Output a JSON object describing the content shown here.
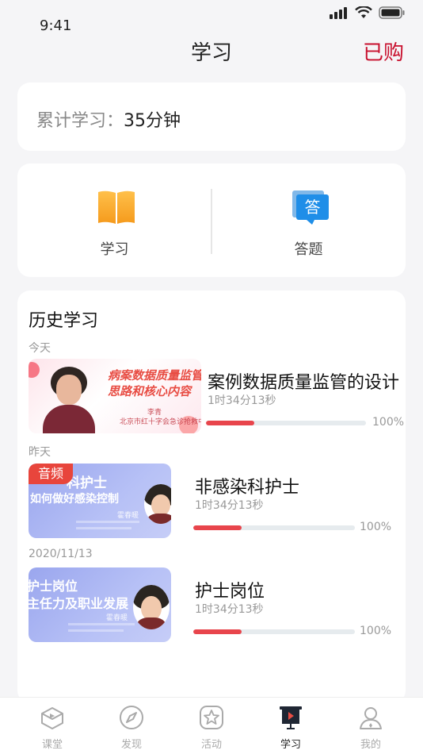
{
  "status_bar": {
    "time": "9:41"
  },
  "nav": {
    "title": "学习",
    "right_label": "已购"
  },
  "summary": {
    "label": "累计学习：",
    "value": "35分钟"
  },
  "entries": [
    {
      "label": "学习",
      "icon": "book-icon"
    },
    {
      "label": "答题",
      "icon": "answer-icon",
      "icon_text": "答"
    }
  ],
  "history": {
    "title": "历史学习",
    "groups": [
      {
        "date": "今天",
        "items": [
          {
            "title": "案例数据质量监管的设计",
            "duration": "1时34分13秒",
            "progress_percent": "100%",
            "progress_fill": 0.3,
            "thumb_lines": [
              "病案数据质量监管的设计",
              "思路和核心内容"
            ],
            "thumb_speaker": "李青",
            "thumb_org": "北京市红十字会急诊抢救中心"
          }
        ]
      },
      {
        "date": "昨天",
        "items": [
          {
            "title": "非感染科护士",
            "duration": "1时34分13秒",
            "progress_percent": "100%",
            "progress_fill": 0.3,
            "badge": "音频",
            "thumb_lines": [
              "科护士",
              "如何做好感染控制"
            ],
            "thumb_speaker": "霍春暖"
          }
        ]
      },
      {
        "date": "2020/11/13",
        "items": [
          {
            "title": "护士岗位",
            "duration": "1时34分13秒",
            "progress_percent": "100%",
            "progress_fill": 0.3,
            "thumb_lines": [
              "护士岗位",
              "主任力及职业发展"
            ],
            "thumb_speaker": "霍春暖"
          }
        ]
      }
    ]
  },
  "tabbar": [
    {
      "label": "课堂",
      "icon": "classroom-icon",
      "active": false
    },
    {
      "label": "发现",
      "icon": "compass-icon",
      "active": false
    },
    {
      "label": "活动",
      "icon": "star-icon",
      "active": false
    },
    {
      "label": "学习",
      "icon": "play-board-icon",
      "active": true
    },
    {
      "label": "我的",
      "icon": "profile-icon",
      "active": false
    }
  ],
  "colors": {
    "brand": "#c8102e",
    "progress": "#e8454c",
    "tab_active": "#222222",
    "tab_inactive": "#aaaaaa"
  }
}
